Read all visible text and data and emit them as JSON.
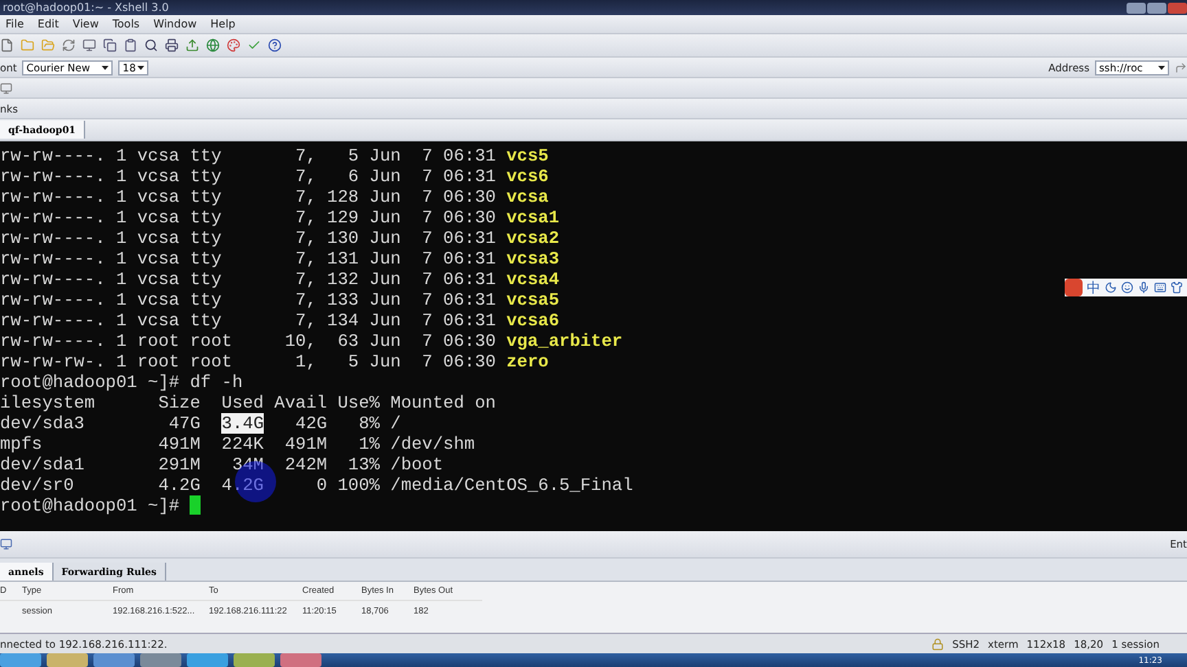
{
  "window": {
    "title": "root@hadoop01:~ - Xshell 3.0"
  },
  "menu": [
    "File",
    "Edit",
    "View",
    "Tools",
    "Window",
    "Help"
  ],
  "font_bar": {
    "label": "ont",
    "font": "Courier New",
    "size": "18"
  },
  "address_bar": {
    "label": "Address",
    "value": "ssh://roc"
  },
  "links_bar": {
    "label": "nks"
  },
  "session_tabs": [
    {
      "label": "qf-hadoop01",
      "selected": true
    }
  ],
  "terminal": {
    "lines": [
      {
        "segments": [
          {
            "text": "rw-rw----. 1 vcsa tty       7,   5 Jun  7 06:31 ",
            "kind": "plain"
          },
          {
            "text": "vcs5",
            "kind": "file"
          }
        ]
      },
      {
        "segments": [
          {
            "text": "rw-rw----. 1 vcsa tty       7,   6 Jun  7 06:31 ",
            "kind": "plain"
          },
          {
            "text": "vcs6",
            "kind": "file"
          }
        ]
      },
      {
        "segments": [
          {
            "text": "rw-rw----. 1 vcsa tty       7, 128 Jun  7 06:30 ",
            "kind": "plain"
          },
          {
            "text": "vcsa",
            "kind": "file"
          }
        ]
      },
      {
        "segments": [
          {
            "text": "rw-rw----. 1 vcsa tty       7, 129 Jun  7 06:30 ",
            "kind": "plain"
          },
          {
            "text": "vcsa1",
            "kind": "file"
          }
        ]
      },
      {
        "segments": [
          {
            "text": "rw-rw----. 1 vcsa tty       7, 130 Jun  7 06:31 ",
            "kind": "plain"
          },
          {
            "text": "vcsa2",
            "kind": "file"
          }
        ]
      },
      {
        "segments": [
          {
            "text": "rw-rw----. 1 vcsa tty       7, 131 Jun  7 06:31 ",
            "kind": "plain"
          },
          {
            "text": "vcsa3",
            "kind": "file"
          }
        ]
      },
      {
        "segments": [
          {
            "text": "rw-rw----. 1 vcsa tty       7, 132 Jun  7 06:31 ",
            "kind": "plain"
          },
          {
            "text": "vcsa4",
            "kind": "file"
          }
        ]
      },
      {
        "segments": [
          {
            "text": "rw-rw----. 1 vcsa tty       7, 133 Jun  7 06:31 ",
            "kind": "plain"
          },
          {
            "text": "vcsa5",
            "kind": "file"
          }
        ]
      },
      {
        "segments": [
          {
            "text": "rw-rw----. 1 vcsa tty       7, 134 Jun  7 06:31 ",
            "kind": "plain"
          },
          {
            "text": "vcsa6",
            "kind": "file"
          }
        ]
      },
      {
        "segments": [
          {
            "text": "rw-rw----. 1 root root     10,  63 Jun  7 06:30 ",
            "kind": "plain"
          },
          {
            "text": "vga_arbiter",
            "kind": "file"
          }
        ]
      },
      {
        "segments": [
          {
            "text": "rw-rw-rw-. 1 root root      1,   5 Jun  7 06:30 ",
            "kind": "plain"
          },
          {
            "text": "zero",
            "kind": "file"
          }
        ]
      },
      {
        "segments": [
          {
            "text": "root@hadoop01 ~]# df -h",
            "kind": "plain"
          }
        ]
      },
      {
        "segments": [
          {
            "text": "ilesystem      Size  Used Avail Use% Mounted on",
            "kind": "plain"
          }
        ]
      },
      {
        "segments": [
          {
            "text": "dev/sda3        47G  ",
            "kind": "plain"
          },
          {
            "text": "3.4G",
            "kind": "selected"
          },
          {
            "text": "   42G   8% /",
            "kind": "plain"
          }
        ]
      },
      {
        "segments": [
          {
            "text": "mpfs           491M  224K  491M   1% /dev/shm",
            "kind": "plain"
          }
        ]
      },
      {
        "segments": [
          {
            "text": "dev/sda1       291M   34M  242M  13% /boot",
            "kind": "plain"
          }
        ]
      },
      {
        "segments": [
          {
            "text": "dev/sr0        4.2G  4.2G     0 100% /media/CentOS_6.5_Final",
            "kind": "plain"
          }
        ]
      },
      {
        "segments": [
          {
            "text": "root@hadoop01 ~]# ",
            "kind": "plain"
          }
        ],
        "cursor": true
      }
    ]
  },
  "ime_bar": {
    "label": "中"
  },
  "compose_bar": {
    "send_label": "Ent"
  },
  "panel": {
    "tabs": [
      {
        "label": "annels",
        "selected": true
      },
      {
        "label": "Forwarding Rules",
        "selected": false
      }
    ],
    "columns": [
      "D",
      "Type",
      "From",
      "To",
      "Created",
      "Bytes In",
      "Bytes Out"
    ],
    "rows": [
      [
        "",
        "session",
        "192.168.216.1:522...",
        "192.168.216.111:22",
        "11:20:15",
        "18,706",
        "182"
      ]
    ]
  },
  "status_bar": {
    "text": "nnected to 192.168.216.111:22.",
    "items": [
      "SSH2",
      "xterm",
      "112x18",
      "18,20",
      "1 session"
    ]
  },
  "taskbar": {
    "clock": "11:23"
  }
}
